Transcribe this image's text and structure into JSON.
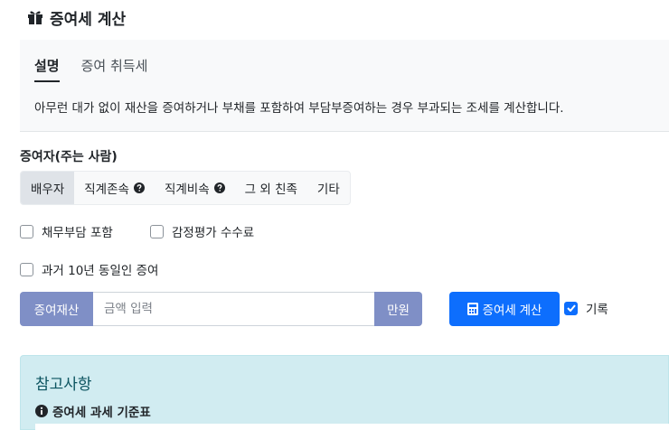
{
  "header": {
    "title": "증여세 계산",
    "icon": "gift-icon"
  },
  "tabs": [
    {
      "label": "설명",
      "active": true
    },
    {
      "label": "증여 취득세",
      "active": false
    }
  ],
  "tab_description": "아무런 대가 없이 재산을 증여하거나 부채를 포함하여 부담부증여하는 경우 부과되는 조세를 계산합니다.",
  "donor": {
    "label": "증여자(주는 사람)",
    "options": [
      {
        "label": "배우자",
        "active": true
      },
      {
        "label": "직계존속",
        "help": true
      },
      {
        "label": "직계비속",
        "help": true
      },
      {
        "label": "그 외 친족"
      },
      {
        "label": "기타"
      }
    ]
  },
  "options": {
    "debt_burden": "채무부담 포함",
    "appraisal_fee": "감정평가 수수료",
    "past_10y": "과거 10년 동일인 증여"
  },
  "amount": {
    "prefix": "증여재산",
    "placeholder": "금액 입력",
    "suffix": "만원"
  },
  "calculate_label": "증여세 계산",
  "record": {
    "label": "기록",
    "checked": true
  },
  "reference": {
    "title": "참고사항",
    "subtitle": "증여세 과세 기준표"
  },
  "colors": {
    "primary": "#0d6efd",
    "addon": "#7f8fc6",
    "info_bg": "#d1ecf1"
  }
}
